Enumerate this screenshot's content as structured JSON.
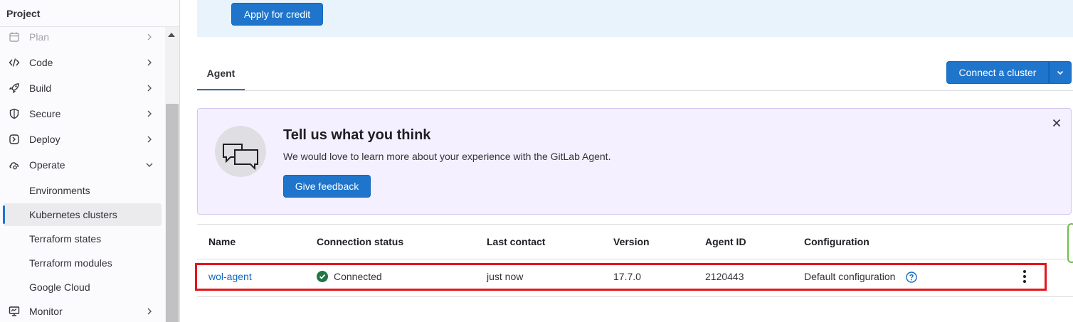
{
  "sidebar": {
    "title": "Project",
    "items": [
      {
        "label": "Plan",
        "icon": "calendar-icon"
      },
      {
        "label": "Code",
        "icon": "code-icon"
      },
      {
        "label": "Build",
        "icon": "rocket-icon"
      },
      {
        "label": "Secure",
        "icon": "shield-icon"
      },
      {
        "label": "Deploy",
        "icon": "deploy-icon"
      },
      {
        "label": "Operate",
        "icon": "cloud-gear-icon"
      },
      {
        "label": "Monitor",
        "icon": "monitor-icon"
      }
    ],
    "operate_sub": [
      "Environments",
      "Kubernetes clusters",
      "Terraform states",
      "Terraform modules",
      "Google Cloud"
    ]
  },
  "banner": {
    "apply_label": "Apply for credit"
  },
  "tabs": {
    "agent": "Agent"
  },
  "actions": {
    "connect_label": "Connect a cluster"
  },
  "feedback": {
    "title": "Tell us what you think",
    "text": "We would love to learn more about your experience with the GitLab Agent.",
    "button": "Give feedback"
  },
  "table": {
    "headers": [
      "Name",
      "Connection status",
      "Last contact",
      "Version",
      "Agent ID",
      "Configuration"
    ],
    "row": {
      "name": "wol-agent",
      "status": "Connected",
      "last_contact": "just now",
      "version": "17.7.0",
      "agent_id": "2120443",
      "configuration": "Default configuration"
    }
  },
  "colors": {
    "accent": "#1f75cb",
    "success": "#217645",
    "highlight": "#e5141b"
  }
}
